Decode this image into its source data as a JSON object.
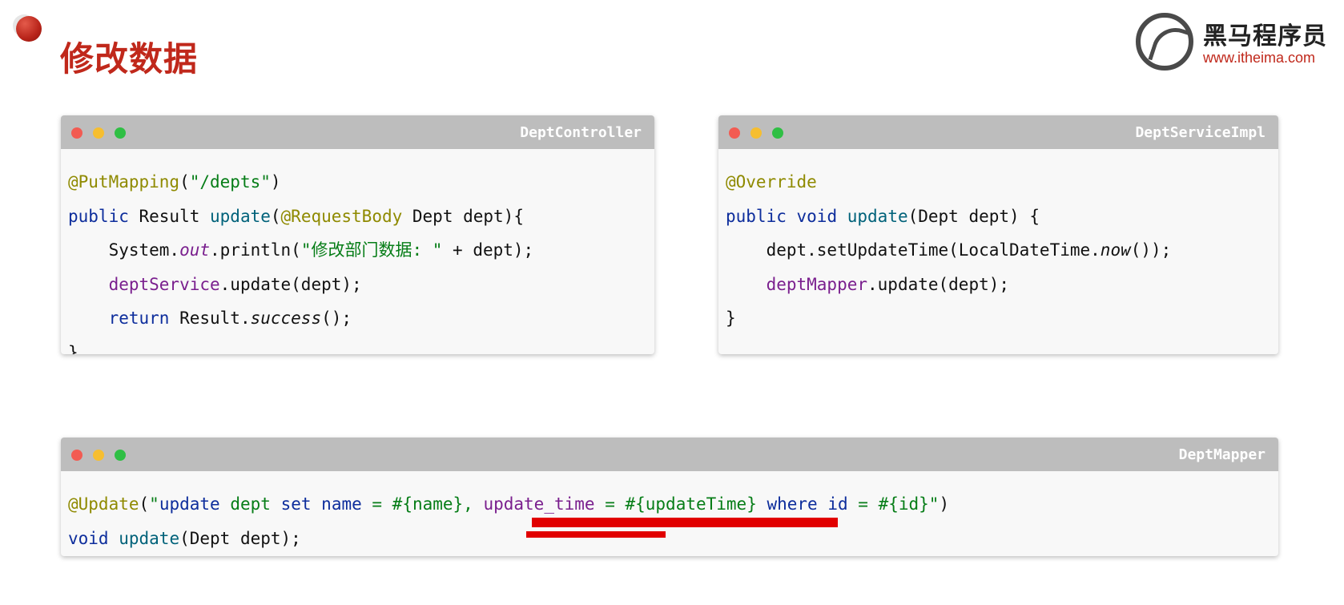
{
  "page": {
    "title": "修改数据"
  },
  "logo": {
    "name": "黑马程序员",
    "url": "www.itheima.com"
  },
  "colors": {
    "title": "#c0281b",
    "titlebar": "#bdbdbd",
    "annotation": "#8f8a00",
    "keyword": "#0d2d9c",
    "method": "#00627a",
    "field": "#7a1f8e",
    "string": "#067d17",
    "highlight": "#e10000"
  },
  "windows": [
    {
      "title": "DeptController",
      "lines": [
        {
          "segments": [
            {
              "t": "@PutMapping",
              "c": "ann"
            },
            {
              "t": "(",
              "c": ""
            },
            {
              "t": "\"/depts\"",
              "c": "str"
            },
            {
              "t": ")",
              "c": ""
            }
          ]
        },
        {
          "segments": [
            {
              "t": "public",
              "c": "kw"
            },
            {
              "t": " Result ",
              "c": ""
            },
            {
              "t": "update",
              "c": "mt"
            },
            {
              "t": "(",
              "c": ""
            },
            {
              "t": "@RequestBody",
              "c": "ann"
            },
            {
              "t": " Dept dept){",
              "c": ""
            }
          ]
        },
        {
          "segments": [
            {
              "t": "    System.",
              "c": ""
            },
            {
              "t": "out",
              "c": "fld it"
            },
            {
              "t": ".println(",
              "c": ""
            },
            {
              "t": "\"修改部门数据: \"",
              "c": "str"
            },
            {
              "t": " + dept);",
              "c": ""
            }
          ]
        },
        {
          "segments": [
            {
              "t": "    ",
              "c": ""
            },
            {
              "t": "deptService",
              "c": "fld"
            },
            {
              "t": ".update(dept);",
              "c": ""
            }
          ]
        },
        {
          "segments": [
            {
              "t": "    ",
              "c": ""
            },
            {
              "t": "return",
              "c": "kw"
            },
            {
              "t": " Result.",
              "c": ""
            },
            {
              "t": "success",
              "c": "it"
            },
            {
              "t": "();",
              "c": ""
            }
          ]
        },
        {
          "segments": [
            {
              "t": "}",
              "c": ""
            }
          ]
        }
      ]
    },
    {
      "title": "DeptServiceImpl",
      "lines": [
        {
          "segments": [
            {
              "t": "@Override",
              "c": "ann"
            }
          ]
        },
        {
          "segments": [
            {
              "t": "public",
              "c": "kw"
            },
            {
              "t": " ",
              "c": ""
            },
            {
              "t": "void",
              "c": "kw"
            },
            {
              "t": " ",
              "c": ""
            },
            {
              "t": "update",
              "c": "mt"
            },
            {
              "t": "(Dept dept) {",
              "c": ""
            }
          ]
        },
        {
          "segments": [
            {
              "t": "    dept.setUpdateTime(LocalDateTime.",
              "c": ""
            },
            {
              "t": "now",
              "c": "it"
            },
            {
              "t": "());",
              "c": ""
            }
          ]
        },
        {
          "segments": [
            {
              "t": "    ",
              "c": ""
            },
            {
              "t": "deptMapper",
              "c": "fld"
            },
            {
              "t": ".update(dept);",
              "c": ""
            }
          ]
        },
        {
          "segments": [
            {
              "t": "}",
              "c": ""
            }
          ]
        }
      ]
    },
    {
      "title": "DeptMapper",
      "lines": [
        {
          "segments": [
            {
              "t": "@Update",
              "c": "ann"
            },
            {
              "t": "(",
              "c": ""
            },
            {
              "t": "\"",
              "c": "str"
            },
            {
              "t": "update",
              "c": "kw"
            },
            {
              "t": " ",
              "c": "str"
            },
            {
              "t": "dept",
              "c": "str"
            },
            {
              "t": " ",
              "c": "str"
            },
            {
              "t": "set",
              "c": "kw"
            },
            {
              "t": " ",
              "c": "str"
            },
            {
              "t": "name",
              "c": "kw"
            },
            {
              "t": " = #{name}, ",
              "c": "str"
            },
            {
              "t": "update_time",
              "c": "fld"
            },
            {
              "t": " = #{updateTime} ",
              "c": "str"
            },
            {
              "t": "where",
              "c": "kw"
            },
            {
              "t": " ",
              "c": "str"
            },
            {
              "t": "id",
              "c": "kw"
            },
            {
              "t": " = #{id}\"",
              "c": "str"
            },
            {
              "t": ")",
              "c": ""
            }
          ]
        },
        {
          "segments": [
            {
              "t": "void",
              "c": "kw"
            },
            {
              "t": " ",
              "c": ""
            },
            {
              "t": "update",
              "c": "mt"
            },
            {
              "t": "(Dept dept);",
              "c": ""
            }
          ]
        }
      ]
    }
  ]
}
